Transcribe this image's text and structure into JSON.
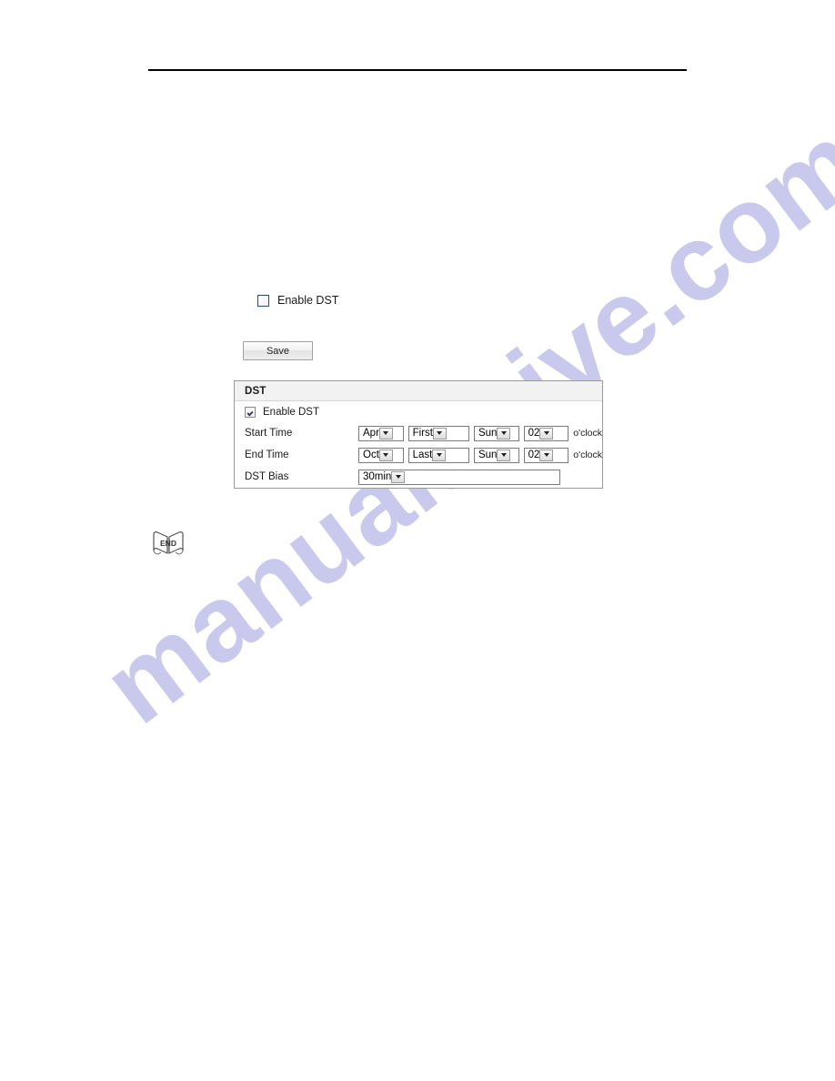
{
  "page": {
    "watermark_text": "manualshive.com",
    "watermark_color": "#c9c9ee",
    "background_color": "#ffffff",
    "header_rule": true
  },
  "enable_dst_toggle": {
    "label": "Enable DST",
    "checked": false,
    "checkbox_border_color": "#2c4f63"
  },
  "save_button": {
    "label": "Save"
  },
  "dst_panel": {
    "title": "DST",
    "enable_dst": {
      "label": "Enable DST",
      "checked": true
    },
    "rows": [
      {
        "label": "Start Time",
        "month": "Apr",
        "week": "First",
        "day": "Sun",
        "hour": "02",
        "suffix": "o'clock"
      },
      {
        "label": "End Time",
        "month": "Oct",
        "week": "Last",
        "day": "Sun",
        "hour": "02",
        "suffix": "o'clock"
      }
    ],
    "bias_row": {
      "label": "DST Bias",
      "value": "30min"
    }
  },
  "end_icon": {
    "label": "END",
    "name": "end-book-icon"
  }
}
